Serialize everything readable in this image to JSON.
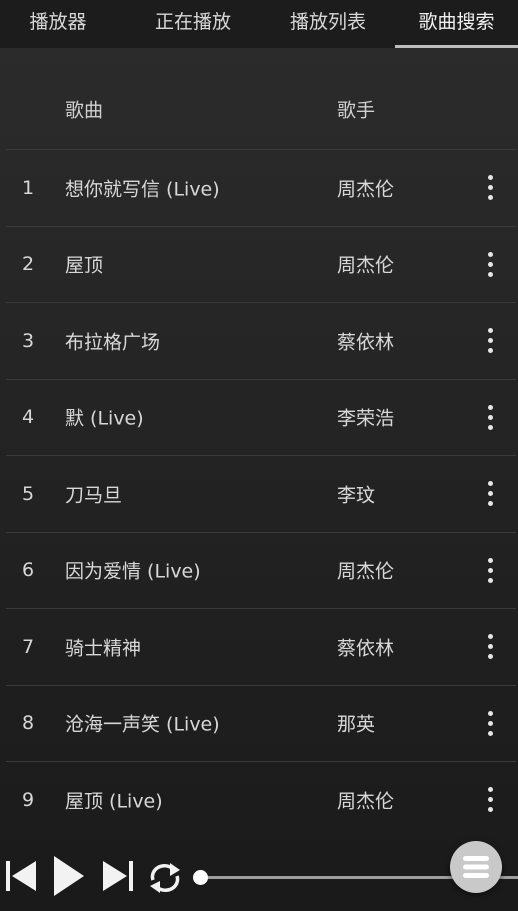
{
  "tabs": [
    "播放器",
    "正在播放",
    "播放列表",
    "歌曲搜索"
  ],
  "active_tab": "歌曲搜索",
  "table": {
    "headers": {
      "song": "歌曲",
      "artist": "歌手"
    },
    "rows": [
      {
        "num": "1",
        "song": "想你就写信 (Live)",
        "artist": "周杰伦"
      },
      {
        "num": "2",
        "song": "屋顶",
        "artist": "周杰伦"
      },
      {
        "num": "3",
        "song": "布拉格广场",
        "artist": "蔡依林"
      },
      {
        "num": "4",
        "song": "默 (Live)",
        "artist": "李荣浩"
      },
      {
        "num": "5",
        "song": "刀马旦",
        "artist": "李玟"
      },
      {
        "num": "6",
        "song": "因为爱情 (Live)",
        "artist": "周杰伦"
      },
      {
        "num": "7",
        "song": "骑士精神",
        "artist": "蔡依林"
      },
      {
        "num": "8",
        "song": "沧海一声笑 (Live)",
        "artist": "那英"
      },
      {
        "num": "9",
        "song": "屋顶 (Live)",
        "artist": "周杰伦"
      }
    ]
  },
  "player": {
    "progress": 0,
    "icons": [
      "previous-icon",
      "play-icon",
      "next-icon",
      "repeat-icon",
      "menu-icon"
    ]
  },
  "colors": {
    "background": "#262626",
    "tabbar": "#1c1c1c",
    "text": "#d8d8d8",
    "divider": "#3a3a3a",
    "fab": "#c9c9c9"
  }
}
